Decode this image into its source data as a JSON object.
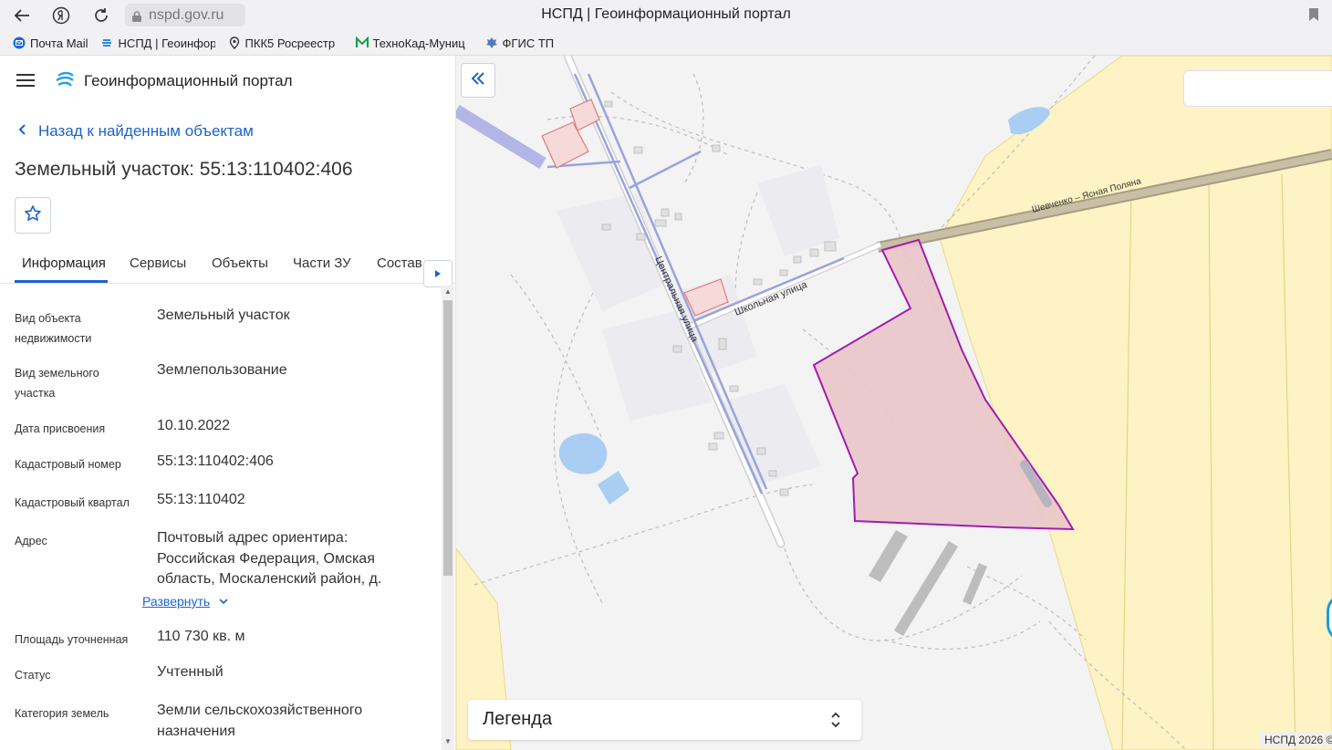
{
  "browser": {
    "url": "nspd.gov.ru",
    "title": "НСПД | Геоинформационный портал",
    "bookmarks": [
      {
        "label": "Почта Mail",
        "icon": "mail-icon"
      },
      {
        "label": "НСПД | Геоинфор",
        "icon": "nspd-icon"
      },
      {
        "label": "ПКК5 Росреестр",
        "icon": "pin-icon"
      },
      {
        "label": "ТехноКад-Муниц",
        "icon": "m-icon"
      },
      {
        "label": "ФГИС ТП",
        "icon": "emblem-icon"
      }
    ]
  },
  "header": {
    "portal_title": "Геоинформационный портал"
  },
  "object": {
    "back_label": "Назад к найденным объектам",
    "title": "Земельный участок: 55:13:110402:406"
  },
  "tabs": [
    {
      "label": "Информация",
      "active": true
    },
    {
      "label": "Сервисы"
    },
    {
      "label": "Объекты"
    },
    {
      "label": "Части ЗУ"
    },
    {
      "label": "Состав"
    }
  ],
  "info": {
    "rows": [
      {
        "label": "Вид объекта недвижимости",
        "value": "Земельный участок"
      },
      {
        "label": "Вид земельного участка",
        "value": "Землепользование"
      },
      {
        "label": "Дата присвоения",
        "value": "10.10.2022"
      },
      {
        "label": "Кадастровый номер",
        "value": "55:13:110402:406"
      },
      {
        "label": "Кадастровый квартал",
        "value": "55:13:110402"
      },
      {
        "label": "Адрес",
        "value": "Почтовый адрес ориентира: Российская Федерация, Омская область, Москаленский район, д."
      },
      {
        "label": "Площадь уточненная",
        "value": "110 730 кв. м"
      },
      {
        "label": "Статус",
        "value": "Учтенный"
      },
      {
        "label": "Категория земель",
        "value": "Земли сельскохозяйственного назначения"
      }
    ],
    "expand_label": "Развернуть"
  },
  "map": {
    "street_labels": {
      "central": "Центральная улица",
      "school": "Школьная улица",
      "road": "Шевченко – Ясная Поляна"
    },
    "legend_label": "Легенда",
    "copyright": "НСПД 2026 ©"
  },
  "colors": {
    "accent": "#1e63c9",
    "parcel_fill": "#e9c5c9",
    "parcel_border": "#a21caf",
    "agri_fill": "#fdf3c4"
  }
}
